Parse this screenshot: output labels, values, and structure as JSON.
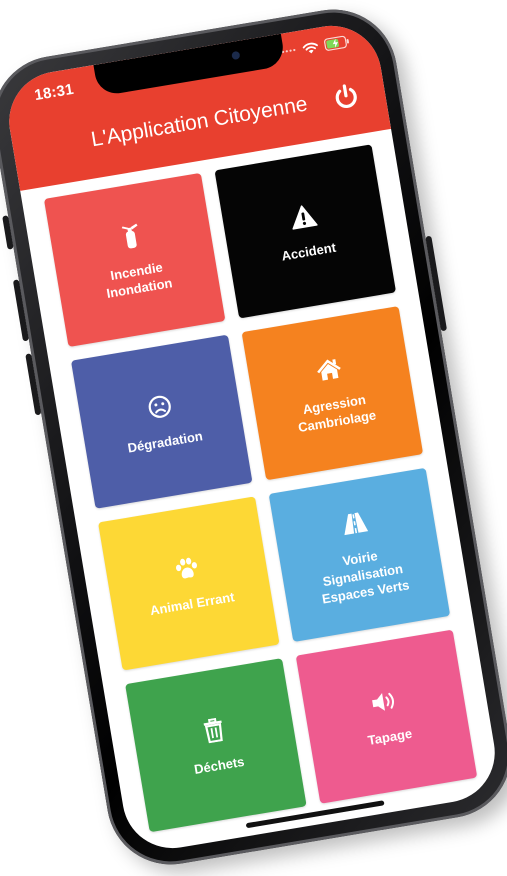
{
  "status_bar": {
    "time": "18:31",
    "signal": "••••"
  },
  "header": {
    "title": "L'Application Citoyenne",
    "bg": "#e8402f"
  },
  "tiles": [
    {
      "label": "Incendie\nInondation",
      "color": "#ef5350",
      "icon": "fire-extinguisher-icon"
    },
    {
      "label": "Accident",
      "color": "#050505",
      "icon": "warning-icon"
    },
    {
      "label": "Dégradation",
      "color": "#4e5ea8",
      "icon": "sad-face-icon"
    },
    {
      "label": "Agression\nCambriolage",
      "color": "#f5821f",
      "icon": "home-icon"
    },
    {
      "label": "Animal Errant",
      "color": "#fdd835",
      "icon": "paw-icon"
    },
    {
      "label": "Voirie\nSignalisation\nEspaces Verts",
      "color": "#5aaee0",
      "icon": "road-icon"
    },
    {
      "label": "Déchets",
      "color": "#3fa34d",
      "icon": "trash-icon"
    },
    {
      "label": "Tapage",
      "color": "#ee5b8f",
      "icon": "speaker-icon"
    }
  ]
}
